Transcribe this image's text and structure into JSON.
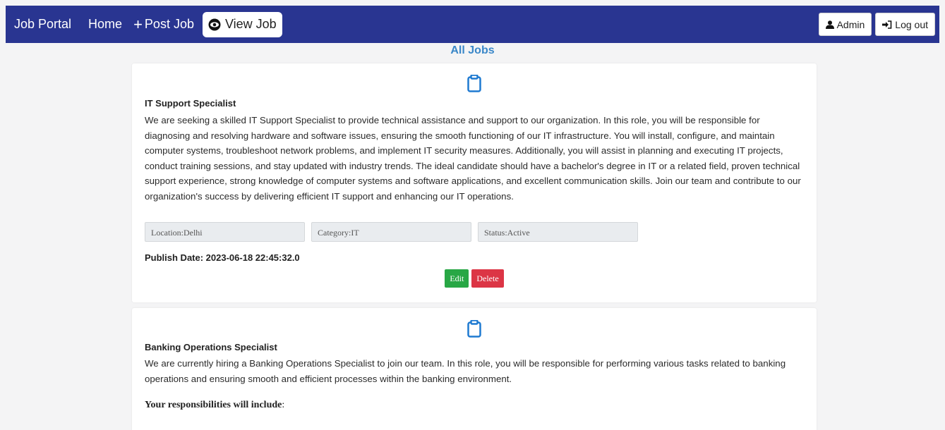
{
  "nav": {
    "brand": "Job Portal",
    "home": "Home",
    "post_job": "Post Job",
    "view_job": "View Job",
    "admin": "Admin",
    "logout": "Log out"
  },
  "page": {
    "title": "All Jobs"
  },
  "jobs": [
    {
      "title": "IT Support Specialist",
      "description": "We are seeking a skilled IT Support Specialist to provide technical assistance and support to our organization. In this role, you will be responsible for diagnosing and resolving hardware and software issues, ensuring the smooth functioning of our IT infrastructure. You will install, configure, and maintain computer systems, troubleshoot network problems, and implement IT security measures. Additionally, you will assist in planning and executing IT projects, conduct training sessions, and stay updated with industry trends. The ideal candidate should have a bachelor's degree in IT or a related field, proven technical support experience, strong knowledge of computer systems and software applications, and excellent communication skills. Join our team and contribute to our organization's success by delivering efficient IT support and enhancing our IT operations.",
      "location": "Location:Delhi",
      "category": "Category:IT",
      "status": "Status:Active",
      "publish_date": "Publish Date: 2023-06-18 22:45:32.0",
      "edit_label": "Edit",
      "delete_label": "Delete"
    },
    {
      "title": "Banking Operations Specialist",
      "description": "We are currently hiring a Banking Operations Specialist to join our team. In this role, you will be responsible for performing various tasks related to banking operations and ensuring smooth and efficient processes within the banking environment.",
      "responsibilities_heading": "Your responsibilities will include",
      "responsibilities_colon": ":"
    }
  ],
  "colors": {
    "navbar": "#293591",
    "title": "#3a87c8",
    "icon": "#1f7ad1",
    "edit": "#28a745",
    "delete": "#dc3545"
  }
}
